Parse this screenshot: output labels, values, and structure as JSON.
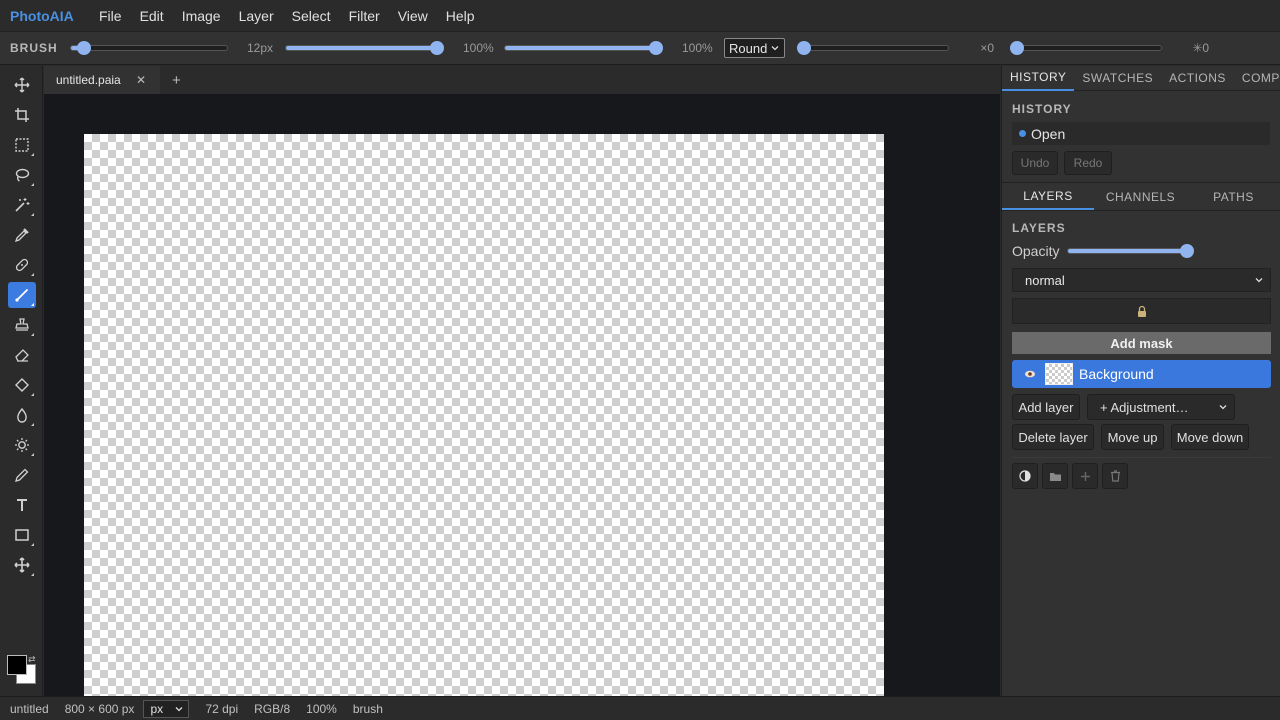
{
  "app": {
    "name": "PhotoAIA"
  },
  "menu": [
    "File",
    "Edit",
    "Image",
    "Layer",
    "Select",
    "Filter",
    "View",
    "Help"
  ],
  "options": {
    "tool_label": "BRUSH",
    "size": {
      "value": 12,
      "min": 1,
      "max": 200,
      "label": "12px"
    },
    "opacity": {
      "value": 100,
      "label": "100%"
    },
    "flow": {
      "value": 100,
      "label": "100%"
    },
    "shape": {
      "selected": "Round"
    },
    "smoothing": {
      "value": 0,
      "label": "×0"
    },
    "spacing": {
      "value": 0,
      "label": "✳0"
    }
  },
  "doc_tabs": [
    {
      "title": "untitled.paia",
      "active": true
    }
  ],
  "panels": {
    "top_tabs": [
      "HISTORY",
      "SWATCHES",
      "ACTIONS",
      "COMPS"
    ],
    "history": {
      "title": "HISTORY",
      "entries": [
        "Open"
      ],
      "undo_label": "Undo",
      "redo_label": "Redo"
    },
    "layer_tabs": [
      "LAYERS",
      "CHANNELS",
      "PATHS"
    ],
    "layers": {
      "title": "LAYERS",
      "opacity_label": "Opacity",
      "opacity_value": 100,
      "blend_mode": "normal",
      "add_mask_label": "Add mask",
      "items": [
        {
          "name": "Background",
          "visible": true,
          "selected": true
        }
      ],
      "add_layer_label": "Add layer",
      "adjustment_label": "+ Adjustment…",
      "delete_layer_label": "Delete layer",
      "move_up_label": "Move up",
      "move_down_label": "Move down"
    }
  },
  "status": {
    "doc_name": "untitled",
    "dimensions": "800 × 600 px",
    "unit": "px",
    "dpi": "72 dpi",
    "mode": "RGB/8",
    "zoom": "100%",
    "tool": "brush"
  },
  "colors": {
    "accent": "#3c7be0",
    "slider": "#8fb4f0",
    "foreground": "#000000",
    "background": "#ffffff"
  }
}
